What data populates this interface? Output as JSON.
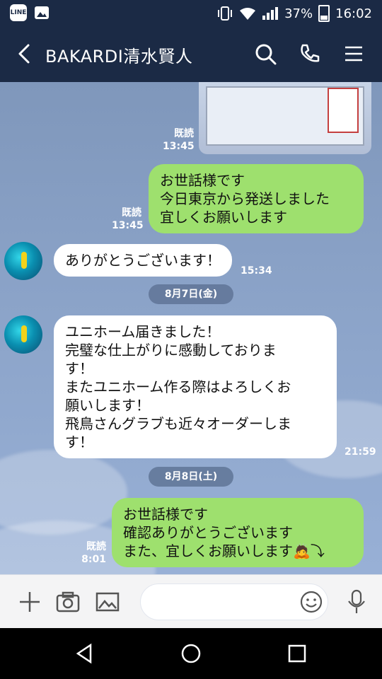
{
  "status_bar": {
    "left_icons": [
      "line-app-icon",
      "gallery-icon"
    ],
    "line_icon_text": "LINE",
    "battery_percent": "37%",
    "time": "16:02"
  },
  "header": {
    "title": "BAKARDI清水賢人"
  },
  "chat": {
    "image_message": {
      "read_label": "既読",
      "time": "13:45"
    },
    "sent_1": {
      "lines": [
        "お世話様です",
        "今日東京から発送しました",
        "宜しくお願いします"
      ],
      "read_label": "既読",
      "time": "13:45"
    },
    "recv_1": {
      "text": "ありがとうございます！",
      "time": "15:34"
    },
    "date_1": "8月7日(金)",
    "recv_2": {
      "lines": [
        "ユニホーム届きました！",
        "完璧な仕上がりに感動しておりま",
        "す！",
        "またユニホーム作る際はよろしくお",
        "願いします！",
        "飛鳥さんグラブも近々オーダーしま",
        "す！"
      ],
      "time": "21:59"
    },
    "date_2": "8月8日(土)",
    "sent_2": {
      "lines": [
        "お世話様です",
        "確認ありがとうございます",
        "また、宜しくお願いします"
      ],
      "emoji_suffix": "🙇⤵",
      "read_label": "既読",
      "time": "8:01"
    }
  },
  "input_bar": {
    "placeholder": ""
  },
  "colors": {
    "header_bg": "#1b2a45",
    "sent_bubble": "#9ee06e",
    "recv_bubble": "#ffffff",
    "chat_bg": "#7f97bb"
  }
}
